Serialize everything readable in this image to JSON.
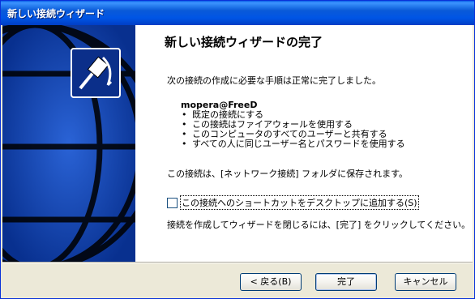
{
  "window": {
    "title": "新しい接続ウィザード"
  },
  "main": {
    "heading": "新しい接続ウィザードの完了",
    "intro": "次の接続の作成に必要な手順は正常に完了しました。",
    "connection_name": "mopera@FreeD",
    "features": [
      "既定の接続にする",
      "この接続はファイアウォールを使用する",
      "このコンピュータのすべてのユーザーと共有する",
      "すべての人に同じユーザー名とパスワードを使用する"
    ],
    "saved_text": "この接続は、[ネットワーク接続] フォルダに保存されます。",
    "shortcut_checkbox": {
      "label": "この接続へのショートカットをデスクトップに追加する(S)",
      "checked": false
    },
    "finish_text": "接続を作成してウィザードを閉じるには、[完了] をクリックしてください。"
  },
  "buttons": {
    "back": "< 戻る(B)",
    "finish": "完了",
    "cancel": "キャンセル"
  },
  "icons": {
    "wizard": "network-cable-icon"
  },
  "colors": {
    "titlebar": "#0055e5",
    "side_panel": "#0b3aa8",
    "dialog_bg": "#ece9d8"
  }
}
